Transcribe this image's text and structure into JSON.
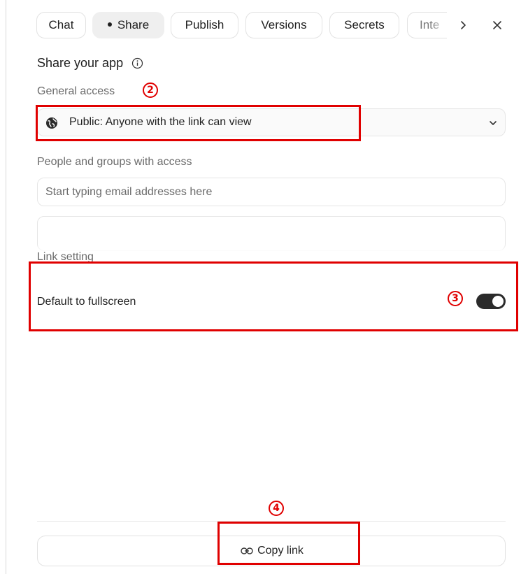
{
  "tabs": [
    {
      "label": "Chat",
      "active": false
    },
    {
      "label": "Share",
      "active": true
    },
    {
      "label": "Publish",
      "active": false
    },
    {
      "label": "Versions",
      "active": false
    },
    {
      "label": "Secrets",
      "active": false
    },
    {
      "label": "Inte",
      "active": false
    }
  ],
  "icons": {
    "next": "chevron-right-icon",
    "close": "close-icon",
    "info": "info-icon",
    "globe": "globe-icon",
    "dropdown": "chevron-down-icon",
    "link": "link-icon"
  },
  "share": {
    "heading": "Share your app",
    "general_access_label": "General access",
    "access_value": "Public: Anyone with the link can view",
    "people_label": "People and groups with access",
    "email_placeholder": "Start typing email addresses here",
    "link_setting_label": "Link setting",
    "fullscreen_label": "Default to fullscreen",
    "fullscreen_enabled": true,
    "copy_link_label": "Copy link"
  },
  "annotations": {
    "step2": "2",
    "step3": "3",
    "step4": "4",
    "color": "#e00000"
  }
}
